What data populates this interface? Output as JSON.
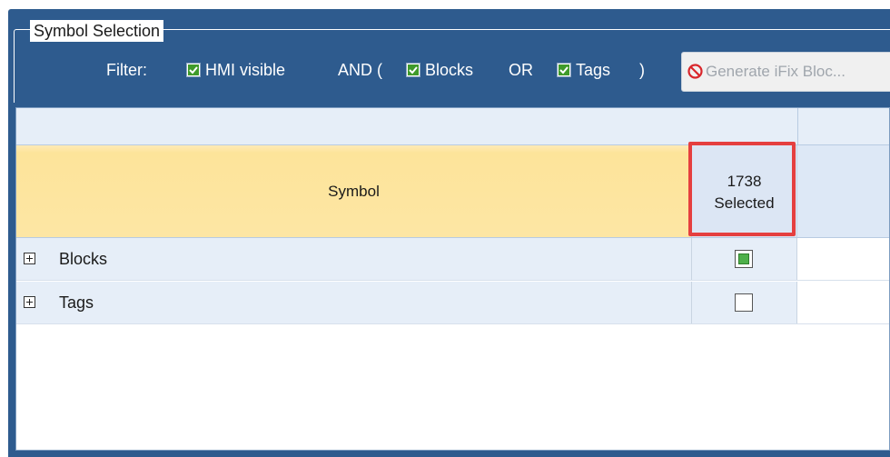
{
  "group": {
    "title": "Symbol Selection"
  },
  "filter": {
    "label": "Filter:",
    "hmi_visible": {
      "label": "HMI visible",
      "checked": true
    },
    "and_open": "AND (",
    "blocks": {
      "label": "Blocks",
      "checked": true
    },
    "or_text": "OR",
    "tags": {
      "label": "Tags",
      "checked": true
    },
    "close_paren": ")"
  },
  "generate_button": {
    "label": "Generate iFix Bloc...",
    "icon": "no-entry-icon",
    "enabled": false
  },
  "table": {
    "columns": {
      "symbol": "Symbol",
      "selected_count": "1738",
      "selected_label": "Selected"
    },
    "rows": [
      {
        "name": "Blocks",
        "selected_state": "partial"
      },
      {
        "name": "Tags",
        "selected_state": "unchecked"
      }
    ]
  },
  "colors": {
    "panel": "#2e5b8e",
    "header_yellow": "#fde49a",
    "highlight": "#e53f3f",
    "check_green": "#3f9a2a"
  }
}
